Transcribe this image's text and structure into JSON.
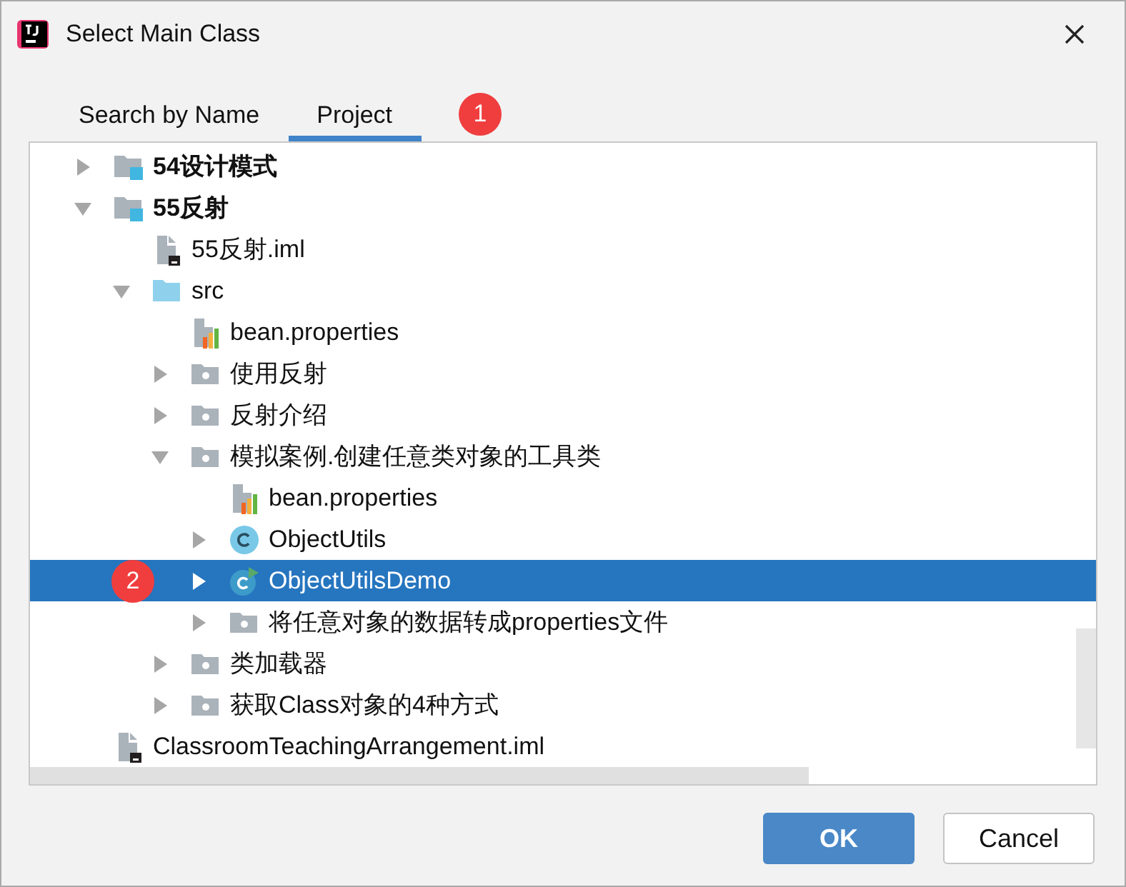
{
  "window": {
    "title": "Select Main Class"
  },
  "tabs": [
    {
      "label": "Search by Name",
      "selected": false
    },
    {
      "label": "Project",
      "selected": true,
      "badge": "1"
    }
  ],
  "tree": [
    {
      "label": "54设计模式",
      "kind": "module",
      "expanded": false,
      "selected": false
    },
    {
      "label": "55反射",
      "kind": "module",
      "expanded": true,
      "selected": false,
      "children": [
        {
          "label": "55反射.iml",
          "kind": "iml",
          "selected": false
        },
        {
          "label": "src",
          "kind": "source-folder",
          "expanded": true,
          "selected": false,
          "children": [
            {
              "label": "bean.properties",
              "kind": "properties",
              "selected": false
            },
            {
              "label": "使用反射",
              "kind": "package",
              "expanded": false,
              "selected": false
            },
            {
              "label": "反射介绍",
              "kind": "package",
              "expanded": false,
              "selected": false
            },
            {
              "label": "模拟案例.创建任意类对象的工具类",
              "kind": "package",
              "expanded": true,
              "selected": false,
              "children": [
                {
                  "label": "bean.properties",
                  "kind": "properties",
                  "selected": false
                },
                {
                  "label": "ObjectUtils",
                  "kind": "class",
                  "expanded": false,
                  "selected": false
                },
                {
                  "label": "ObjectUtilsDemo",
                  "kind": "runnable-class",
                  "expanded": false,
                  "selected": true,
                  "badge": "2"
                },
                {
                  "label": "将任意对象的数据转成properties文件",
                  "kind": "package",
                  "expanded": false,
                  "selected": false
                }
              ]
            },
            {
              "label": "类加载器",
              "kind": "package",
              "expanded": false,
              "selected": false
            },
            {
              "label": "获取Class对象的4种方式",
              "kind": "package",
              "expanded": false,
              "selected": false
            }
          ]
        }
      ]
    },
    {
      "label": "ClassroomTeachingArrangement.iml",
      "kind": "iml",
      "selected": false
    }
  ],
  "buttons": [
    {
      "label": "OK",
      "kind": "primary"
    },
    {
      "label": "Cancel",
      "kind": "secondary"
    }
  ]
}
